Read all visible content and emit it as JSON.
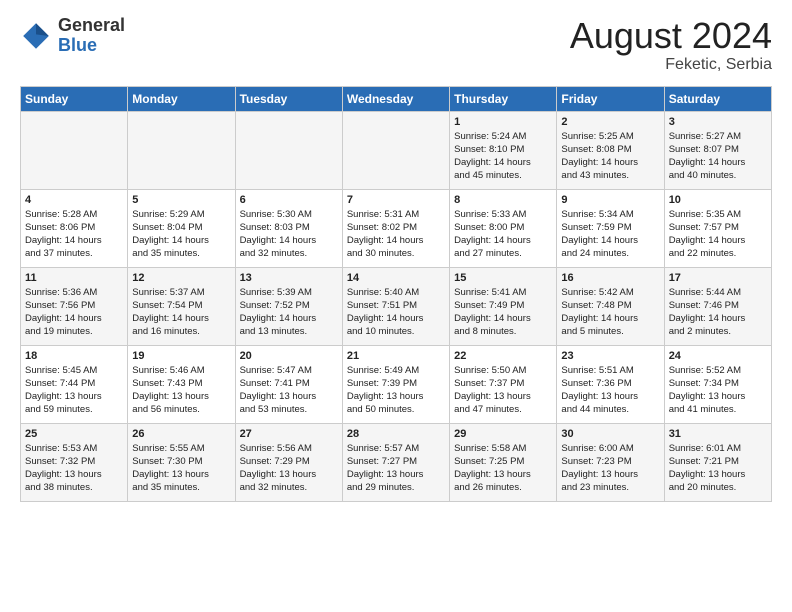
{
  "header": {
    "logo_general": "General",
    "logo_blue": "Blue",
    "month_year": "August 2024",
    "location": "Feketic, Serbia"
  },
  "days_of_week": [
    "Sunday",
    "Monday",
    "Tuesday",
    "Wednesday",
    "Thursday",
    "Friday",
    "Saturday"
  ],
  "weeks": [
    [
      {
        "day": "",
        "content": ""
      },
      {
        "day": "",
        "content": ""
      },
      {
        "day": "",
        "content": ""
      },
      {
        "day": "",
        "content": ""
      },
      {
        "day": "1",
        "content": "Sunrise: 5:24 AM\nSunset: 8:10 PM\nDaylight: 14 hours\nand 45 minutes."
      },
      {
        "day": "2",
        "content": "Sunrise: 5:25 AM\nSunset: 8:08 PM\nDaylight: 14 hours\nand 43 minutes."
      },
      {
        "day": "3",
        "content": "Sunrise: 5:27 AM\nSunset: 8:07 PM\nDaylight: 14 hours\nand 40 minutes."
      }
    ],
    [
      {
        "day": "4",
        "content": "Sunrise: 5:28 AM\nSunset: 8:06 PM\nDaylight: 14 hours\nand 37 minutes."
      },
      {
        "day": "5",
        "content": "Sunrise: 5:29 AM\nSunset: 8:04 PM\nDaylight: 14 hours\nand 35 minutes."
      },
      {
        "day": "6",
        "content": "Sunrise: 5:30 AM\nSunset: 8:03 PM\nDaylight: 14 hours\nand 32 minutes."
      },
      {
        "day": "7",
        "content": "Sunrise: 5:31 AM\nSunset: 8:02 PM\nDaylight: 14 hours\nand 30 minutes."
      },
      {
        "day": "8",
        "content": "Sunrise: 5:33 AM\nSunset: 8:00 PM\nDaylight: 14 hours\nand 27 minutes."
      },
      {
        "day": "9",
        "content": "Sunrise: 5:34 AM\nSunset: 7:59 PM\nDaylight: 14 hours\nand 24 minutes."
      },
      {
        "day": "10",
        "content": "Sunrise: 5:35 AM\nSunset: 7:57 PM\nDaylight: 14 hours\nand 22 minutes."
      }
    ],
    [
      {
        "day": "11",
        "content": "Sunrise: 5:36 AM\nSunset: 7:56 PM\nDaylight: 14 hours\nand 19 minutes."
      },
      {
        "day": "12",
        "content": "Sunrise: 5:37 AM\nSunset: 7:54 PM\nDaylight: 14 hours\nand 16 minutes."
      },
      {
        "day": "13",
        "content": "Sunrise: 5:39 AM\nSunset: 7:52 PM\nDaylight: 14 hours\nand 13 minutes."
      },
      {
        "day": "14",
        "content": "Sunrise: 5:40 AM\nSunset: 7:51 PM\nDaylight: 14 hours\nand 10 minutes."
      },
      {
        "day": "15",
        "content": "Sunrise: 5:41 AM\nSunset: 7:49 PM\nDaylight: 14 hours\nand 8 minutes."
      },
      {
        "day": "16",
        "content": "Sunrise: 5:42 AM\nSunset: 7:48 PM\nDaylight: 14 hours\nand 5 minutes."
      },
      {
        "day": "17",
        "content": "Sunrise: 5:44 AM\nSunset: 7:46 PM\nDaylight: 14 hours\nand 2 minutes."
      }
    ],
    [
      {
        "day": "18",
        "content": "Sunrise: 5:45 AM\nSunset: 7:44 PM\nDaylight: 13 hours\nand 59 minutes."
      },
      {
        "day": "19",
        "content": "Sunrise: 5:46 AM\nSunset: 7:43 PM\nDaylight: 13 hours\nand 56 minutes."
      },
      {
        "day": "20",
        "content": "Sunrise: 5:47 AM\nSunset: 7:41 PM\nDaylight: 13 hours\nand 53 minutes."
      },
      {
        "day": "21",
        "content": "Sunrise: 5:49 AM\nSunset: 7:39 PM\nDaylight: 13 hours\nand 50 minutes."
      },
      {
        "day": "22",
        "content": "Sunrise: 5:50 AM\nSunset: 7:37 PM\nDaylight: 13 hours\nand 47 minutes."
      },
      {
        "day": "23",
        "content": "Sunrise: 5:51 AM\nSunset: 7:36 PM\nDaylight: 13 hours\nand 44 minutes."
      },
      {
        "day": "24",
        "content": "Sunrise: 5:52 AM\nSunset: 7:34 PM\nDaylight: 13 hours\nand 41 minutes."
      }
    ],
    [
      {
        "day": "25",
        "content": "Sunrise: 5:53 AM\nSunset: 7:32 PM\nDaylight: 13 hours\nand 38 minutes."
      },
      {
        "day": "26",
        "content": "Sunrise: 5:55 AM\nSunset: 7:30 PM\nDaylight: 13 hours\nand 35 minutes."
      },
      {
        "day": "27",
        "content": "Sunrise: 5:56 AM\nSunset: 7:29 PM\nDaylight: 13 hours\nand 32 minutes."
      },
      {
        "day": "28",
        "content": "Sunrise: 5:57 AM\nSunset: 7:27 PM\nDaylight: 13 hours\nand 29 minutes."
      },
      {
        "day": "29",
        "content": "Sunrise: 5:58 AM\nSunset: 7:25 PM\nDaylight: 13 hours\nand 26 minutes."
      },
      {
        "day": "30",
        "content": "Sunrise: 6:00 AM\nSunset: 7:23 PM\nDaylight: 13 hours\nand 23 minutes."
      },
      {
        "day": "31",
        "content": "Sunrise: 6:01 AM\nSunset: 7:21 PM\nDaylight: 13 hours\nand 20 minutes."
      }
    ]
  ]
}
